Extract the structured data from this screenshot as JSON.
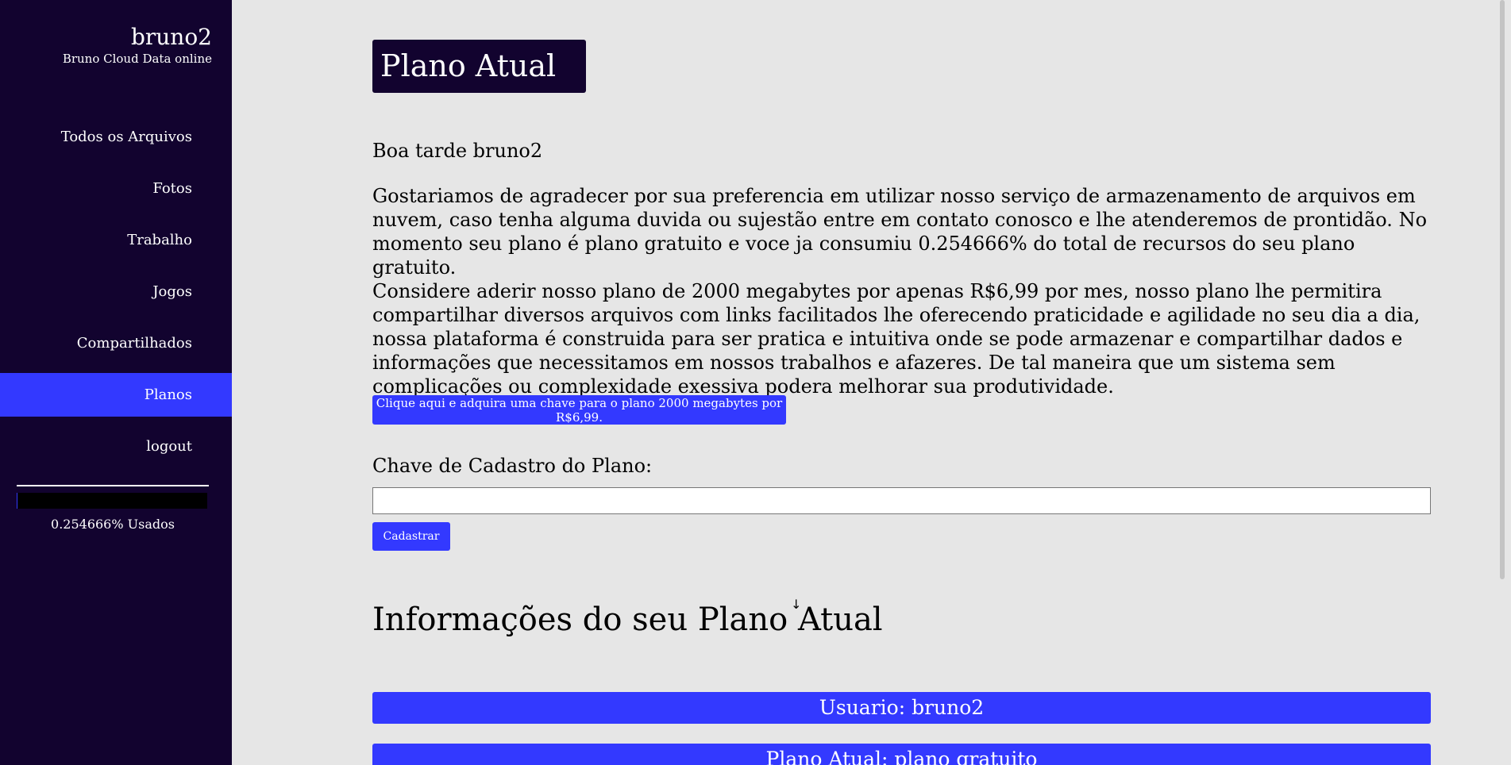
{
  "sidebar": {
    "brand_name": "bruno2",
    "brand_subtitle": "Bruno Cloud Data online",
    "items": [
      {
        "label": "Todos os Arquivos"
      },
      {
        "label": "Fotos"
      },
      {
        "label": "Trabalho"
      },
      {
        "label": "Jogos"
      },
      {
        "label": "Compartilhados"
      },
      {
        "label": "Planos"
      },
      {
        "label": "logout"
      }
    ],
    "active_item": "Planos",
    "usage_text": "0.254666% Usados",
    "usage_fraction": 0.00254666
  },
  "main": {
    "title": "Plano Atual",
    "greeting": "Boa tarde bruno2",
    "paragraph1": "Gostariamos de agradecer por sua preferencia em utilizar nosso serviço de armazenamento de arquivos em nuvem, caso tenha alguma duvida ou sujestão entre em contato conosco e lhe atenderemos de prontidão. No momento seu plano é plano gratuito e voce ja consumiu 0.254666% do total de recursos do seu plano gratuito.",
    "paragraph2": "Considere aderir nosso plano de 2000 megabytes por apenas R$6,99 por mes, nosso plano lhe permitira compartilhar diversos arquivos com links facilitados lhe oferecendo praticidade e agilidade no seu dia a dia, nossa plataforma é construida para ser pratica e intuitiva onde se pode armazenar e compartilhar dados e informações que necessitamos em nossos trabalhos e afazeres. De tal maneira que um sistema sem complicações ou complexidade exessiva podera melhorar sua produtividade.",
    "buy_button_label": "Clique aqui e adquira uma chave para o plano 2000 megabytes por R$6,99.",
    "key_label": "Chave de Cadastro do Plano:",
    "key_value": "",
    "register_button_label": "Cadastrar",
    "info_title": "Informações do seu Plano Atual",
    "info_rows": [
      {
        "text": "Usuario: bruno2"
      },
      {
        "text": "Plano Atual: plano gratuito"
      }
    ]
  },
  "colors": {
    "sidebar_bg": "#12032f",
    "accent": "#3339ff",
    "page_bg": "#e6e6e6"
  },
  "icons": {
    "arrow": "arrow-down-icon"
  }
}
